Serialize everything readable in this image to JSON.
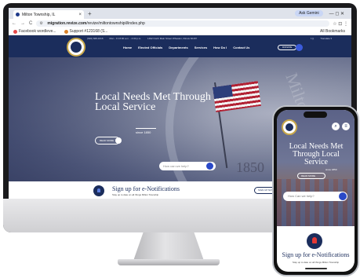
{
  "browser": {
    "tab_title": "Milton Township, IL",
    "tab_close": "×",
    "new_tab": "+",
    "gemini_label": "Ask Gemini",
    "window_controls": "—   ◻   ✕",
    "nav_back": "←",
    "nav_forward": "→",
    "nav_reload": "C",
    "url_host": "migration.revize.com",
    "url_path": "/revize/miltontownshipil/index.php",
    "addr_icons": "☆  ⊡  ⋮",
    "bookmarks": [
      {
        "label": "Facebook wordleve...",
        "color": "#e64a4a"
      },
      {
        "label": "Support #123168 (S...",
        "color": "#d9822b"
      }
    ],
    "all_bookmarks": "All Bookmarks"
  },
  "site": {
    "util": [
      "(630) 668-1616",
      "Mon - Fri 8:00 a.m. - 4:30 p.m.",
      "1492 North Main Street Wheaton, Illinois 60187"
    ],
    "util_right": [
      "f  ◎",
      "Translate ▾"
    ],
    "nav": [
      "Home",
      "Elected Officials",
      "Departments",
      "Services",
      "How Do I",
      "Contact Us"
    ],
    "donate_label": "DONATE",
    "hero_title": "Local Needs Met Through Local Service",
    "hero_since": "since 1850",
    "readmore_label": "READ MORE",
    "search_placeholder": "How can we help?",
    "seal_year": "1850",
    "seal_text": "Milton",
    "signup_title": "Sign up for e-Notifications",
    "signup_sub": "Stay up to date on all things Milton Township",
    "signup_button": "SIGN UP NOW"
  },
  "phone": {
    "hero_title": "Local Needs Met Through Local Service",
    "hero_since": "since 1850",
    "readmore_label": "READ MORE",
    "search_placeholder": "How Can we help?",
    "signup_title": "Sign up for e-Notifications",
    "signup_sub": "Stay up to date on all things Milton Township",
    "menu_icon": "≡",
    "search_icon": "⌕"
  }
}
